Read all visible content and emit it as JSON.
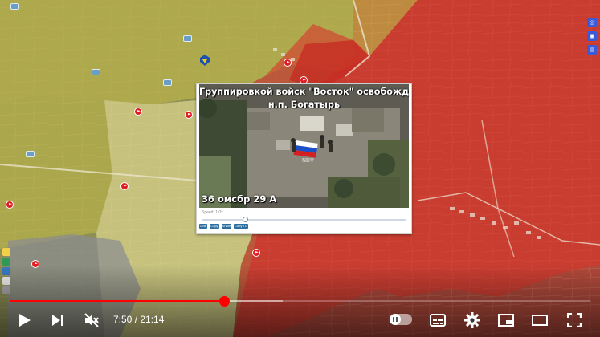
{
  "video": {
    "title_line1": "Группировкой войск \"Восток\" освобожден",
    "title_line2": "н.п. Богатырь",
    "unit_caption": "36 омсбр 29 А",
    "watermark": "NDV"
  },
  "popup": {
    "speed_label": "Speed: 1.0x",
    "buttons": [
      "Link",
      "Copy",
      "Share",
      "Copy TG"
    ]
  },
  "player": {
    "current_time": "7:50",
    "duration": "21:14",
    "time_display": "7:50 / 21:14",
    "progress_fraction": 0.369,
    "buffered_fraction": 0.47
  },
  "colors": {
    "accent_red": "#ff0000",
    "russian_zone": "#d9372c",
    "ukrainian_zone": "#c9c046",
    "contested_zone": "#e9e28a",
    "sidebar_blue": "#3c5ad7"
  },
  "icons": {
    "play": "play-icon",
    "next": "next-icon",
    "mute": "mute-icon",
    "autoplay": "autoplay-toggle",
    "subtitles": "subtitles-icon",
    "settings": "gear-icon",
    "miniplayer": "miniplayer-icon",
    "theater": "theater-icon",
    "fullscreen": "fullscreen-icon"
  }
}
